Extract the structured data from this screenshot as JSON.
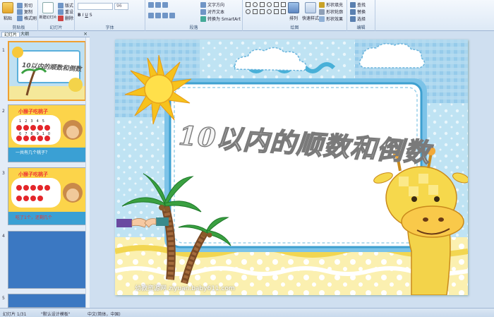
{
  "ribbon": {
    "groups": [
      {
        "label": "剪贴板",
        "buttons": [
          "粘贴",
          "剪切",
          "复制",
          "格式刷"
        ]
      },
      {
        "label": "幻灯片",
        "buttons": [
          "新建幻灯片",
          "版式",
          "重设",
          "删除"
        ]
      },
      {
        "label": "字体",
        "font_size": "96"
      },
      {
        "label": "段落",
        "buttons": [
          "文字方向",
          "对齐文本",
          "转换为 SmartArt"
        ]
      },
      {
        "label": "绘图",
        "buttons": [
          "排列",
          "快速样式",
          "形状填充",
          "形状轮廓",
          "形状效果"
        ]
      },
      {
        "label": "编辑",
        "buttons": [
          "查找",
          "替换",
          "选择"
        ]
      }
    ]
  },
  "panel": {
    "tabs": [
      "幻灯片",
      "大纲"
    ],
    "close": "×",
    "thumbs": [
      {
        "num": "1",
        "title": "10以内的顺数和倒数"
      },
      {
        "num": "2",
        "title": "小猴子吃桃子",
        "numbers": [
          "1",
          "2",
          "3",
          "4",
          "5",
          "6",
          "7",
          "8",
          "9",
          "10"
        ],
        "caption": "一共有几个桃子？"
      },
      {
        "num": "3",
        "title": "小猴子吃桃子",
        "caption": "吃了1个，还剩几个"
      },
      {
        "num": "4",
        "title": ""
      },
      {
        "num": "5",
        "title": ""
      }
    ]
  },
  "slide": {
    "title": "10以内的顺数和倒数",
    "watermark": "幼教资源网 ziyuan.baby611.com"
  },
  "status": {
    "slide_info": "幻灯片 1/31",
    "theme": "\"默认设计模板\"",
    "language": "中文(简体，中国)"
  }
}
